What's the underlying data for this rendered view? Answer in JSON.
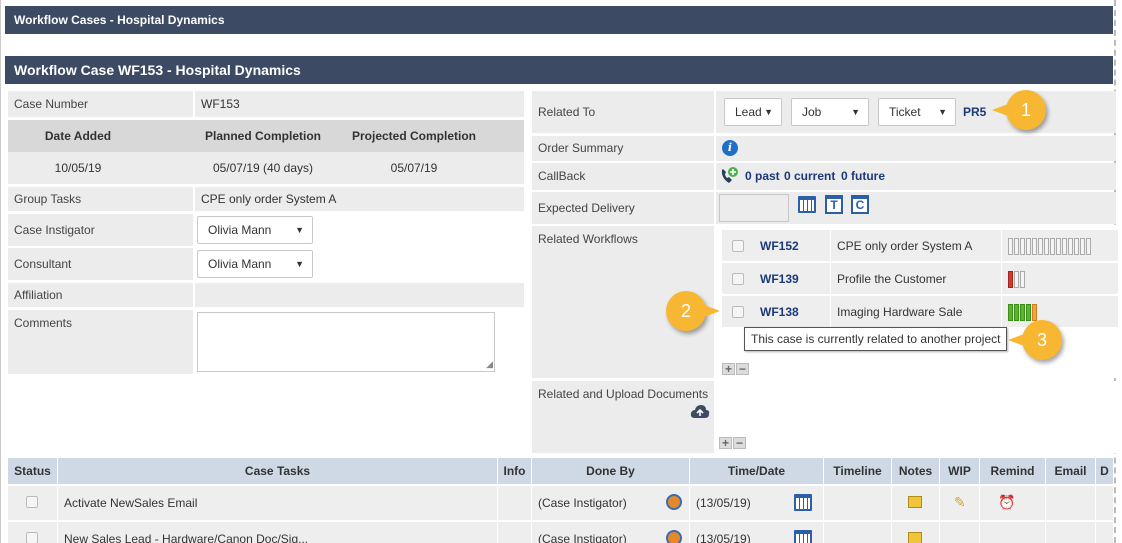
{
  "header": {
    "title": "Workflow Cases - Hospital Dynamics"
  },
  "case": {
    "title": "Workflow Case WF153 - Hospital Dynamics"
  },
  "left": {
    "case_number_label": "Case Number",
    "case_number_value": "WF153",
    "dates": {
      "headers": [
        "Date Added",
        "Planned Completion",
        "Projected Completion"
      ],
      "values": [
        "10/05/19",
        "05/07/19 (40 days)",
        "05/07/19"
      ]
    },
    "group_tasks_label": "Group Tasks",
    "group_tasks_value": "CPE only order System A",
    "instigator_label": "Case Instigator",
    "instigator_value": "Olivia Mann",
    "consultant_label": "Consultant",
    "consultant_value": "Olivia Mann",
    "affiliation_label": "Affiliation",
    "comments_label": "Comments"
  },
  "right": {
    "related_to_label": "Related To",
    "related_selects": [
      "Lead",
      "Job",
      "Ticket"
    ],
    "related_value": "PR5",
    "order_summary_label": "Order Summary",
    "callback_label": "CallBack",
    "callback": {
      "past": "0 past",
      "current": "0 current",
      "future": "0 future"
    },
    "expected_delivery_label": "Expected Delivery",
    "expected_t": "T",
    "expected_c": "C",
    "related_workflows_label": "Related Workflows",
    "workflows": [
      {
        "id": "WF152",
        "name": "CPE only order System A",
        "progress": "0 of 14"
      },
      {
        "id": "WF139",
        "name": "Profile the Customer",
        "progress": "1 of 3"
      },
      {
        "id": "WF138",
        "name": "Imaging Hardware Sale",
        "progress": "5 of 5"
      }
    ],
    "tooltip": "This case is currently related to another project",
    "docs_label": "Related and Upload Documents",
    "plus": "+",
    "minus": "−"
  },
  "callouts": [
    "1",
    "2",
    "3"
  ],
  "tasks": {
    "headers": [
      "Status",
      "Case Tasks",
      "Info",
      "Done By",
      "Time/Date",
      "Timeline",
      "Notes",
      "WIP",
      "Remind",
      "Email",
      "D"
    ],
    "rows": [
      {
        "task": "Activate NewSales Email",
        "done_by": "(Case Instigator)",
        "date": "(13/05/19)"
      },
      {
        "task": "New Sales Lead - Hardware/Canon Doc/Sig...",
        "done_by": "(Case Instigator)",
        "date": "(13/05/19)"
      }
    ]
  },
  "colors": {
    "header_bg": "#3c4a64",
    "callout": "#f7b733",
    "link": "#1b3a7a"
  }
}
